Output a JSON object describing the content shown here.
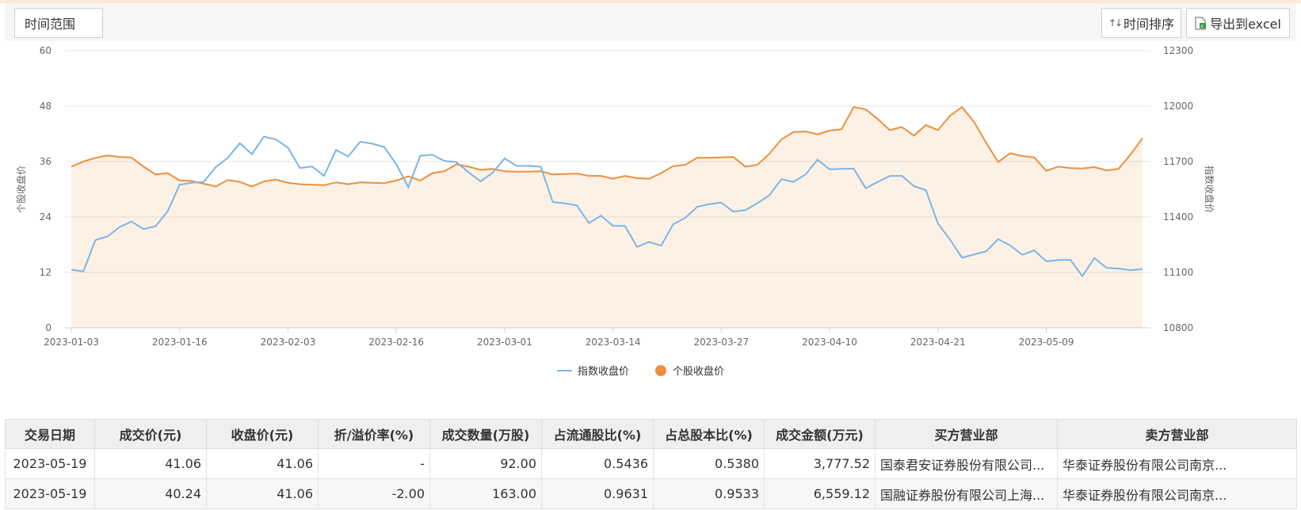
{
  "toolbar": {
    "range_label": "时间范围",
    "sort_label": "时间排序",
    "export_label": "导出到excel"
  },
  "chart_data": {
    "type": "line",
    "x": [
      "2023-01-03",
      "2023-01-04",
      "2023-01-05",
      "2023-01-06",
      "2023-01-09",
      "2023-01-10",
      "2023-01-11",
      "2023-01-12",
      "2023-01-13",
      "2023-01-16",
      "2023-01-17",
      "2023-01-18",
      "2023-01-19",
      "2023-01-20",
      "2023-01-30",
      "2023-01-31",
      "2023-02-01",
      "2023-02-02",
      "2023-02-03",
      "2023-02-06",
      "2023-02-07",
      "2023-02-08",
      "2023-02-09",
      "2023-02-10",
      "2023-02-13",
      "2023-02-14",
      "2023-02-15",
      "2023-02-16",
      "2023-02-17",
      "2023-02-20",
      "2023-02-21",
      "2023-02-22",
      "2023-02-23",
      "2023-02-24",
      "2023-02-27",
      "2023-02-28",
      "2023-03-01",
      "2023-03-02",
      "2023-03-03",
      "2023-03-06",
      "2023-03-07",
      "2023-03-08",
      "2023-03-09",
      "2023-03-10",
      "2023-03-13",
      "2023-03-14",
      "2023-03-15",
      "2023-03-16",
      "2023-03-17",
      "2023-03-20",
      "2023-03-21",
      "2023-03-22",
      "2023-03-23",
      "2023-03-24",
      "2023-03-27",
      "2023-03-28",
      "2023-03-29",
      "2023-03-30",
      "2023-03-31",
      "2023-04-03",
      "2023-04-04",
      "2023-04-06",
      "2023-04-07",
      "2023-04-10",
      "2023-04-11",
      "2023-04-12",
      "2023-04-13",
      "2023-04-14",
      "2023-04-17",
      "2023-04-18",
      "2023-04-19",
      "2023-04-20",
      "2023-04-21",
      "2023-04-24",
      "2023-04-25",
      "2023-04-26",
      "2023-04-27",
      "2023-04-28",
      "2023-05-04",
      "2023-05-05",
      "2023-05-08",
      "2023-05-09",
      "2023-05-10",
      "2023-05-11",
      "2023-05-12",
      "2023-05-15",
      "2023-05-16",
      "2023-05-17",
      "2023-05-18",
      "2023-05-19"
    ],
    "x_ticks": [
      "2023-01-03",
      "2023-01-16",
      "2023-02-03",
      "2023-02-16",
      "2023-03-01",
      "2023-03-14",
      "2023-03-27",
      "2023-04-10",
      "2023-04-21",
      "2023-05-09"
    ],
    "series": [
      {
        "name": "指数收盘价",
        "axis": "right",
        "color": "#7cb5e6",
        "values": [
          11115,
          11105,
          11275,
          11295,
          11345,
          11375,
          11335,
          11350,
          11430,
          11575,
          11585,
          11590,
          11670,
          11720,
          11800,
          11740,
          11835,
          11820,
          11775,
          11665,
          11673,
          11623,
          11763,
          11727,
          11807,
          11797,
          11778,
          11685,
          11561,
          11731,
          11737,
          11703,
          11697,
          11642,
          11593,
          11640,
          11717,
          11676,
          11677,
          11672,
          11481,
          11474,
          11463,
          11367,
          11407,
          11353,
          11351,
          11238,
          11265,
          11245,
          11360,
          11395,
          11455,
          11470,
          11478,
          11429,
          11437,
          11475,
          11518,
          11605,
          11590,
          11630,
          11710,
          11658,
          11660,
          11662,
          11555,
          11590,
          11622,
          11623,
          11567,
          11545,
          11365,
          11278,
          11180,
          11197,
          11214,
          11280,
          11246,
          11195,
          11219,
          11160,
          11167,
          11168,
          11080,
          11178,
          11125,
          11121,
          11112,
          11118
        ]
      },
      {
        "name": "个股收盘价",
        "axis": "left",
        "color": "#ed8f3e",
        "values": [
          34.9,
          36.0,
          36.8,
          37.3,
          37.0,
          36.9,
          34.9,
          33.2,
          33.5,
          31.9,
          31.8,
          31.2,
          30.6,
          32.0,
          31.6,
          30.6,
          31.7,
          32.1,
          31.4,
          31.1,
          31.0,
          30.9,
          31.5,
          31.1,
          31.5,
          31.4,
          31.3,
          31.9,
          32.8,
          31.9,
          33.5,
          33.9,
          35.4,
          34.9,
          34.2,
          34.4,
          33.9,
          33.8,
          33.8,
          33.9,
          33.2,
          33.3,
          33.4,
          32.9,
          32.9,
          32.3,
          32.9,
          32.4,
          32.3,
          33.5,
          35.0,
          35.3,
          36.8,
          36.8,
          36.9,
          37.0,
          34.9,
          35.3,
          37.7,
          40.8,
          42.4,
          42.5,
          41.9,
          42.7,
          43.0,
          47.8,
          47.3,
          45.2,
          42.8,
          43.5,
          41.6,
          43.9,
          42.8,
          45.9,
          47.8,
          44.6,
          40.1,
          35.9,
          37.8,
          37.2,
          36.9,
          34.0,
          34.9,
          34.6,
          34.5,
          34.8,
          34.1,
          34.4,
          37.5,
          41.06
        ]
      }
    ],
    "y_left": {
      "label": "个股收盘价",
      "ylim": [
        0,
        60
      ],
      "ticks": [
        0,
        12,
        24,
        36,
        48,
        60
      ]
    },
    "y_right": {
      "label": "指数收盘价",
      "ylim": [
        10800,
        12300
      ],
      "ticks": [
        10800,
        11100,
        11400,
        11700,
        12000,
        12300
      ]
    },
    "legend_placement": "bottom-center",
    "grid": true
  },
  "table": {
    "headers": [
      "交易日期",
      "成交价(元)",
      "收盘价(元)",
      "折/溢价率(%)",
      "成交数量(万股)",
      "占流通股比(%)",
      "占总股本比(%)",
      "成交金额(万元)",
      "买方营业部",
      "卖方营业部"
    ],
    "rows": [
      [
        "2023-05-19",
        "41.06",
        "41.06",
        "-",
        "92.00",
        "0.5436",
        "0.5380",
        "3,777.52",
        "国泰君安证券股份有限公司...",
        "华泰证券股份有限公司南京..."
      ],
      [
        "2023-05-19",
        "40.24",
        "41.06",
        "-2.00",
        "163.00",
        "0.9631",
        "0.9533",
        "6,559.12",
        "国融证券股份有限公司上海...",
        "华泰证券股份有限公司南京..."
      ]
    ]
  }
}
